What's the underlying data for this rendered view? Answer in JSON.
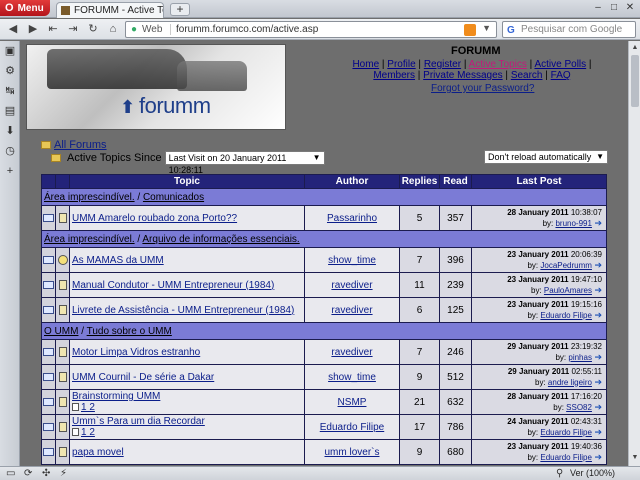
{
  "browser": {
    "menu_label": "Menu",
    "tab_title": "FORUMM - Active Top...",
    "url_prefix": "Web",
    "url": "forumm.forumco.com/active.asp",
    "search_placeholder": "Pesquisar com Google",
    "zoom_label": "Ver (100%)"
  },
  "site": {
    "title": "FORUMM",
    "logo_text": "forumm",
    "nav": [
      {
        "label": "Home"
      },
      {
        "label": "Profile"
      },
      {
        "label": "Register"
      },
      {
        "label": "Active Topics"
      },
      {
        "label": "Active Polls"
      },
      {
        "label": "Members"
      },
      {
        "label": "Private Messages"
      },
      {
        "label": "Search"
      },
      {
        "label": "FAQ"
      }
    ],
    "forgot_password": "Forgot your Password?"
  },
  "filters": {
    "all_forums": "All Forums",
    "active_since_label": "Active Topics Since",
    "since_value": "Last Visit on 20 January 2011 10:28:11",
    "reload_value": "Don't reload automatically"
  },
  "table": {
    "headers": [
      "Topic",
      "Author",
      "Replies",
      "Read",
      "Last Post"
    ],
    "categories": [
      {
        "cat": "Área imprescindível.",
        "forum": "Comunicados",
        "rows": [
          {
            "topic": "UMM Amarelo roubado zona Porto??",
            "author": "Passarinho",
            "replies": "5",
            "read": "357",
            "date": "28 January 2011",
            "time": "10:38:07",
            "by": "by:",
            "last_author": "bruno-991",
            "icon": "doc"
          }
        ]
      },
      {
        "cat": "Área imprescindível.",
        "forum": "Arquivo de informações essenciais.",
        "rows": [
          {
            "topic": "As MAMAS da UMM",
            "author": "show_time",
            "replies": "7",
            "read": "396",
            "date": "23 January 2011",
            "time": "20:06:39",
            "by": "by:",
            "last_author": "JocaPedrumm",
            "icon": "smile"
          },
          {
            "topic": "Manual Condutor - UMM Entrepreneur (1984)",
            "author": "ravediver",
            "replies": "11",
            "read": "239",
            "date": "23 January 2011",
            "time": "19:47:10",
            "by": "by:",
            "last_author": "PauloAmares",
            "icon": "doc"
          },
          {
            "topic": "Livrete de Assistência - UMM Entrepreneur (1984)",
            "author": "ravediver",
            "replies": "6",
            "read": "125",
            "date": "23 January 2011",
            "time": "19:15:16",
            "by": "by:",
            "last_author": "Eduardo Filipe",
            "icon": "doc"
          }
        ]
      },
      {
        "cat": "O UMM",
        "forum": "Tudo sobre o UMM",
        "rows": [
          {
            "topic": "Motor Limpa Vidros estranho",
            "author": "ravediver",
            "replies": "7",
            "read": "246",
            "date": "29 January 2011",
            "time": "23:19:32",
            "by": "by:",
            "last_author": "pinhas",
            "icon": "doc"
          },
          {
            "topic": "UMM Cournil - De série a Dakar",
            "author": "show_time",
            "replies": "9",
            "read": "512",
            "date": "29 January 2011",
            "time": "02:55:11",
            "by": "by:",
            "last_author": "andre ligeiro",
            "icon": "doc"
          },
          {
            "topic": "Brainstorming UMM",
            "pages": "1 2",
            "author": "NSMP",
            "replies": "21",
            "read": "632",
            "date": "28 January 2011",
            "time": "17:16:20",
            "by": "by:",
            "last_author": "SSO82",
            "icon": "doc"
          },
          {
            "topic": "Umm`s Para um dia Recordar",
            "pages": "1 2",
            "author": "Eduardo Filipe",
            "replies": "17",
            "read": "786",
            "date": "24 January 2011",
            "time": "02:43:31",
            "by": "by:",
            "last_author": "Eduardo Filipe",
            "icon": "doc"
          },
          {
            "topic": "papa movel",
            "author": "umm lover`s",
            "replies": "9",
            "read": "680",
            "date": "23 January 2011",
            "time": "19:40:36",
            "by": "by:",
            "last_author": "Eduardo Filipe",
            "icon": "doc"
          }
        ]
      }
    ]
  }
}
